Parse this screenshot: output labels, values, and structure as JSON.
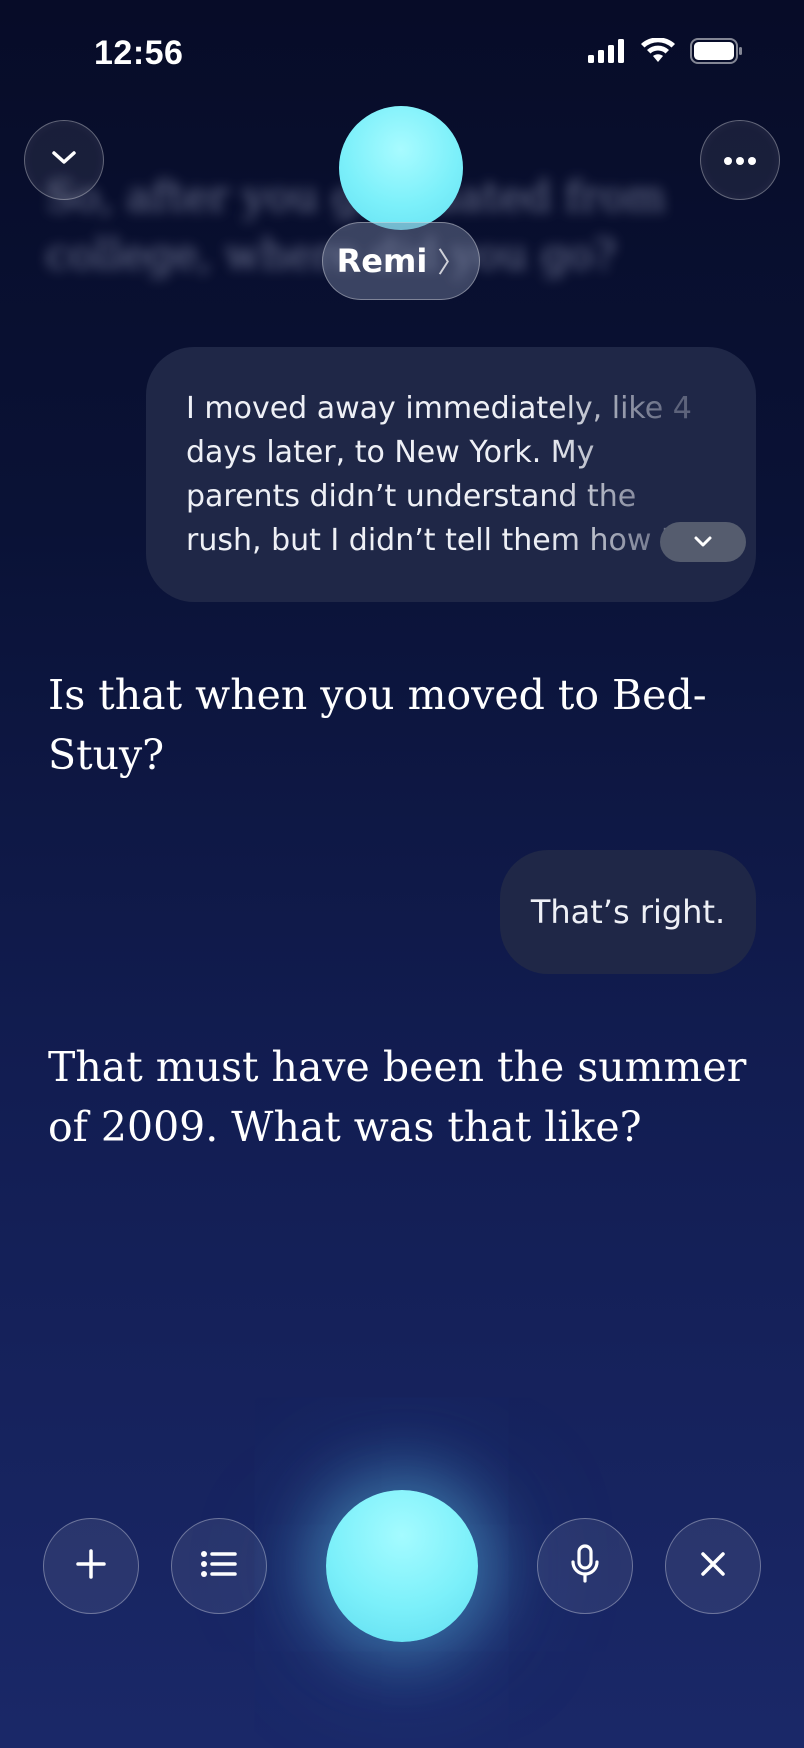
{
  "status_bar": {
    "time": "12:56",
    "icons": [
      "signal-icon",
      "wifi-icon",
      "battery-icon"
    ]
  },
  "header": {
    "collapse_icon": "chevron-down-icon",
    "more_icon": "more-icon",
    "assistant_name": "Remi",
    "name_chevron": "〉"
  },
  "conversation": {
    "previous_question_blurred": "So, after you graduated from college, where did you go?",
    "messages": [
      {
        "role": "user",
        "text": "I moved away immediately, like 4 days later, to New York. My parents didn’t understand the rush, but I didn’t tell them how I"
      },
      {
        "role": "assistant",
        "text": "Is that when you moved to Bed-Stuy?"
      },
      {
        "role": "user",
        "text": "That’s right."
      },
      {
        "role": "assistant",
        "text": "That must have been the summer of 2009. What was that like?"
      }
    ]
  },
  "toolbar": {
    "buttons": [
      "plus-icon",
      "list-icon",
      "voice-orb",
      "microphone-icon",
      "close-icon"
    ]
  },
  "colors": {
    "background_top": "#070c28",
    "background_bottom": "#1a2868",
    "bubble": "#1f2747",
    "orb": "#7cf0fa"
  }
}
